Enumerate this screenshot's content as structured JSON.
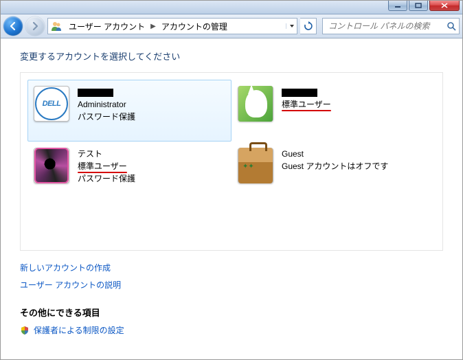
{
  "breadcrumb": {
    "seg1": "ユーザー アカウント",
    "seg2": "アカウントの管理"
  },
  "search": {
    "placeholder": "コントロール パネルの検索"
  },
  "prompt": "変更するアカウントを選択してください",
  "accounts": {
    "admin": {
      "line1": "Administrator",
      "line2": "パスワード保護"
    },
    "user2": {
      "line1": "標準ユーザー"
    },
    "test": {
      "line1": "テスト",
      "line2": "標準ユーザー",
      "line3": "パスワード保護"
    },
    "guest": {
      "line1": "Guest",
      "line2": "Guest アカウントはオフです"
    }
  },
  "links": {
    "create": "新しいアカウントの作成",
    "explain": "ユーザー アカウントの説明"
  },
  "other": {
    "heading": "その他にできる項目",
    "parental": "保護者による制限の設定"
  },
  "icons": {
    "dell": "DELL"
  }
}
